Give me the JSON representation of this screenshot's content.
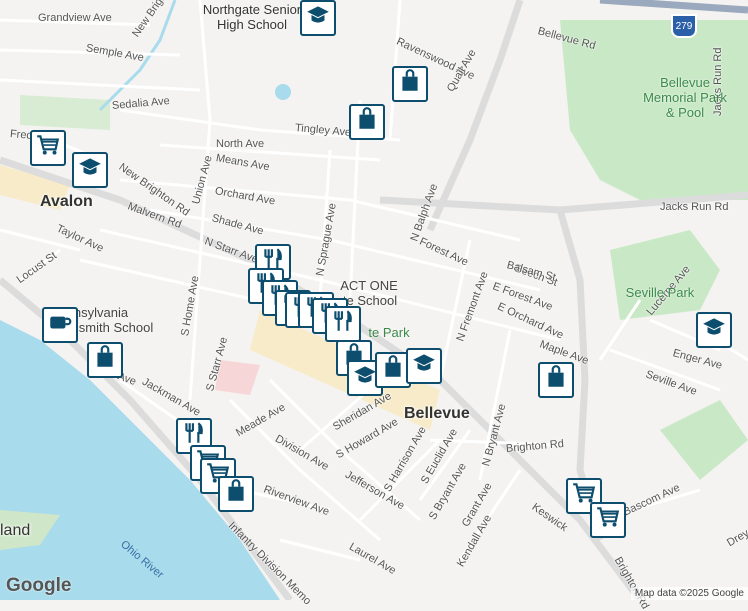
{
  "colors": {
    "water": "#a8dbeb",
    "park": "#c9e8c6",
    "road": "#ffffff",
    "major_road": "#d8d8d8",
    "poi_border": "#0d4d6e"
  },
  "street_labels": [
    {
      "text": "Grandview Ave",
      "rot": 0
    },
    {
      "text": "Semple Ave",
      "rot": 10
    },
    {
      "text": "New Brighton",
      "rot": -55
    },
    {
      "text": "Sedalia Ave",
      "rot": -5
    },
    {
      "text": "Fredrick St",
      "rot": 5
    },
    {
      "text": "New Brighton Rd",
      "rot": 35
    },
    {
      "text": "Orchard Ave",
      "rot": 10
    },
    {
      "text": "Shade Ave",
      "rot": 15
    },
    {
      "text": "N Starr Ave",
      "rot": 20
    },
    {
      "text": "Malvern Rd",
      "rot": 20
    },
    {
      "text": "Taylor Ave",
      "rot": 25
    },
    {
      "text": "Locust St",
      "rot": -35
    },
    {
      "text": "North Ave",
      "rot": 0
    },
    {
      "text": "Means Ave",
      "rot": 10
    },
    {
      "text": "Union Ave",
      "rot": -75
    },
    {
      "text": "Tingley Ave",
      "rot": 5
    },
    {
      "text": "N Sprague Ave",
      "rot": -80
    },
    {
      "text": "Ravenswood Ave",
      "rot": 25
    },
    {
      "text": "Quail Ave",
      "rot": -60
    },
    {
      "text": "Bellevue Rd",
      "rot": 15
    },
    {
      "text": "Jacks Run Rd",
      "rot": 0
    },
    {
      "text": "Jacks Run Rd",
      "rot": -90
    },
    {
      "text": "N Balph Ave",
      "rot": -70
    },
    {
      "text": "Forest Ave",
      "rot": 25
    },
    {
      "text": "Beech St",
      "rot": 20
    },
    {
      "text": "Balsam St",
      "rot": 15
    },
    {
      "text": "E Forest Ave",
      "rot": 20
    },
    {
      "text": "E Orchard Ave",
      "rot": 25
    },
    {
      "text": "N Fremont Ave",
      "rot": -70
    },
    {
      "text": "Maple Ave",
      "rot": 20
    },
    {
      "text": "Lucerne Ave",
      "rot": -50
    },
    {
      "text": "Enger Ave",
      "rot": 15
    },
    {
      "text": "Seville Ave",
      "rot": 20
    },
    {
      "text": "S Home Ave",
      "rot": -80
    },
    {
      "text": "S Starr Ave",
      "rot": -75
    },
    {
      "text": "Jackman Ave",
      "rot": 30
    },
    {
      "text": "Meade Ave",
      "rot": -30
    },
    {
      "text": "Division Ave",
      "rot": 30
    },
    {
      "text": "Sheridan Ave",
      "rot": -30
    },
    {
      "text": "S Howard Ave",
      "rot": -30
    },
    {
      "text": "Jefferson Ave",
      "rot": 30
    },
    {
      "text": "S Harrison Ave",
      "rot": -60
    },
    {
      "text": "S Euclid Ave",
      "rot": -60
    },
    {
      "text": "N Bryant Ave",
      "rot": -75
    },
    {
      "text": "S Bryant Ave",
      "rot": -60
    },
    {
      "text": "Brighton Rd",
      "rot": -5
    },
    {
      "text": "Grant Ave",
      "rot": -60
    },
    {
      "text": "Kendall Ave",
      "rot": -60
    },
    {
      "text": "Keswick",
      "rot": 35
    },
    {
      "text": "Bascom Ave",
      "rot": -25
    },
    {
      "text": "Brighton Rd",
      "rot": 60
    },
    {
      "text": "Riverview Ave",
      "rot": 20
    },
    {
      "text": "Laurel Ave",
      "rot": 30
    },
    {
      "text": "Infantry Division Memo",
      "rot": 45
    },
    {
      "text": "Ohio River",
      "rot": 40
    },
    {
      "text": "Ave",
      "rot": 20
    },
    {
      "text": "Dreyer",
      "rot": -30
    }
  ],
  "places": {
    "northgate": "Northgate Senior High School",
    "bellevue_park": "Bellevue Memorial Park & Pool",
    "seville_park": "Seville Park",
    "act_one": "ACT ONE",
    "act_one_sub": "te School",
    "te_park": "te Park",
    "pennsylvania": "nsylvania",
    "smith_school": "smith School",
    "avalon": "Avalon",
    "bellevue": "Bellevue",
    "land_fragment": "land"
  },
  "shield": "279",
  "footer": {
    "logo": "Google",
    "credit": "Map data ©2025 Google"
  },
  "pois": [
    {
      "type": "school"
    },
    {
      "type": "shopping-bag"
    },
    {
      "type": "shopping-bag"
    },
    {
      "type": "shopping-cart"
    },
    {
      "type": "school"
    },
    {
      "type": "coffee"
    },
    {
      "type": "shopping-bag"
    },
    {
      "type": "restaurant"
    },
    {
      "type": "restaurant"
    },
    {
      "type": "restaurant"
    },
    {
      "type": "restaurant"
    },
    {
      "type": "restaurant"
    },
    {
      "type": "restaurant"
    },
    {
      "type": "restaurant"
    },
    {
      "type": "restaurant"
    },
    {
      "type": "shopping-bag"
    },
    {
      "type": "school"
    },
    {
      "type": "shopping-bag"
    },
    {
      "type": "school"
    },
    {
      "type": "shopping-bag"
    },
    {
      "type": "school"
    },
    {
      "type": "restaurant"
    },
    {
      "type": "shopping-cart"
    },
    {
      "type": "shopping-cart"
    },
    {
      "type": "shopping-bag"
    },
    {
      "type": "shopping-cart"
    },
    {
      "type": "shopping-cart"
    }
  ]
}
